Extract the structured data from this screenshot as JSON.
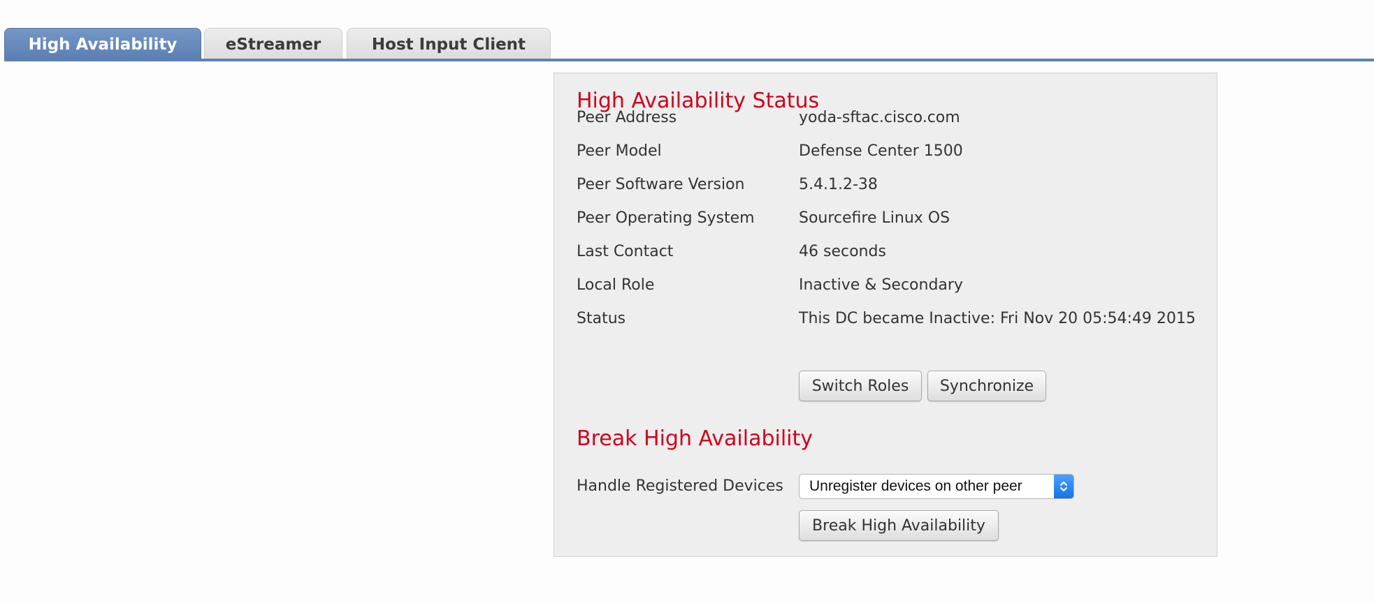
{
  "tabs": [
    {
      "label": "High Availability",
      "active": true
    },
    {
      "label": "eStreamer",
      "active": false
    },
    {
      "label": "Host Input Client",
      "active": false
    }
  ],
  "status_section": {
    "title": "High Availability Status",
    "rows": [
      {
        "label": "Peer Address",
        "value": "yoda-sftac.cisco.com"
      },
      {
        "label": "Peer Model",
        "value": "Defense Center 1500"
      },
      {
        "label": "Peer Software Version",
        "value": "5.4.1.2-38"
      },
      {
        "label": "Peer Operating System",
        "value": "Sourcefire Linux OS"
      },
      {
        "label": "Last Contact",
        "value": "46 seconds"
      },
      {
        "label": "Local Role",
        "value": "Inactive & Secondary"
      },
      {
        "label": "Status",
        "value": "This DC became Inactive: Fri Nov 20 05:54:49 2015"
      }
    ],
    "switch_roles_label": "Switch Roles",
    "synchronize_label": "Synchronize"
  },
  "break_section": {
    "title": "Break High Availability",
    "handle_label": "Handle Registered Devices",
    "handle_selected": "Unregister devices on other peer",
    "break_button_label": "Break High Availability"
  },
  "colors": {
    "accent_heading": "#d0021b",
    "tab_active": "#5d80b1",
    "select_arrow": "#1673e6"
  },
  "icons": {
    "select_arrows": "up-down-chevron-icon"
  }
}
